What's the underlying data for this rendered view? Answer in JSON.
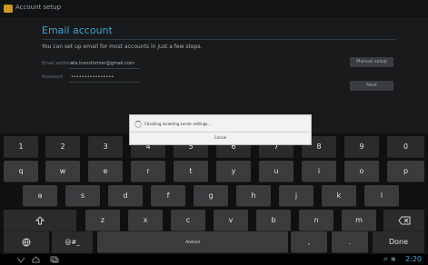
{
  "title": "Account setup",
  "email_title": "Email account",
  "intro": "You can set up email for most accounts in just a few steps.",
  "email_label": "Email address",
  "email_value": "ela.transformer@gmail.com",
  "password_label": "Password",
  "password_value": "••••••••••••••••",
  "manual_setup": "Manual setup",
  "next": "Next",
  "dialog_message": "Checking incoming server settings...",
  "dialog_cancel": "Cancel",
  "row1": [
    "1",
    "2",
    "3",
    "4",
    "5",
    "6",
    "7",
    "8",
    "9",
    "0"
  ],
  "row2": [
    "q",
    "w",
    "e",
    "r",
    "t",
    "y",
    "u",
    "i",
    "o",
    "p"
  ],
  "row3": [
    "a",
    "s",
    "d",
    "f",
    "g",
    "h",
    "j",
    "k",
    "l"
  ],
  "row4": [
    "z",
    "x",
    "c",
    "v",
    "b",
    "n",
    "m"
  ],
  "symbols_key": "@#_",
  "space_hint": "Android",
  "comma": ",",
  "period": ".",
  "done": "Done",
  "clock": "2:20",
  "icons": {
    "shift": "shift-icon",
    "backspace": "backspace-icon",
    "globe": "globe-icon",
    "back": "back-icon",
    "home": "home-icon",
    "recent": "recent-apps-icon"
  },
  "colors": {
    "accent": "#3aa4d6",
    "dialog": "#f2f2f2"
  }
}
